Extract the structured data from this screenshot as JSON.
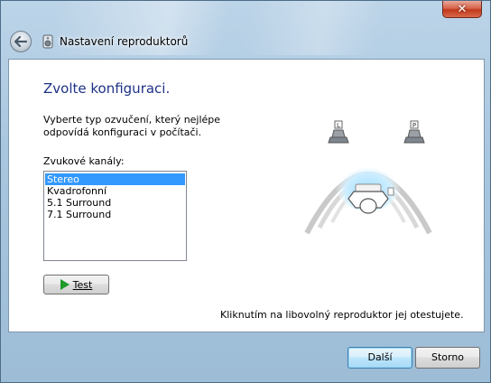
{
  "window": {
    "title": "Nastavení reproduktorů",
    "close_glyph": "✕"
  },
  "page": {
    "heading": "Zvolte konfiguraci.",
    "instruction": "Vyberte typ ozvučení, který nejlépe odpovídá konfiguraci v počítači.",
    "channels_label": "Zvukové kanály:",
    "channels": [
      {
        "label": "Stereo",
        "selected": true
      },
      {
        "label": "Kvadrofonní",
        "selected": false
      },
      {
        "label": "5.1 Surround",
        "selected": false
      },
      {
        "label": "7.1 Surround",
        "selected": false
      }
    ],
    "test_button": "Test",
    "hint": "Kliknutím na libovolný reproduktor jej otestujete.",
    "speaker_left_label": "L",
    "speaker_right_label": "P"
  },
  "footer": {
    "next_button": "Další",
    "cancel_button": "Storno"
  },
  "colors": {
    "heading": "#1e3287",
    "selection": "#3399ff",
    "play_icon": "#1e9a2a"
  },
  "icons": {
    "back": "back-arrow-icon",
    "title": "speaker-icon",
    "play": "play-icon"
  }
}
